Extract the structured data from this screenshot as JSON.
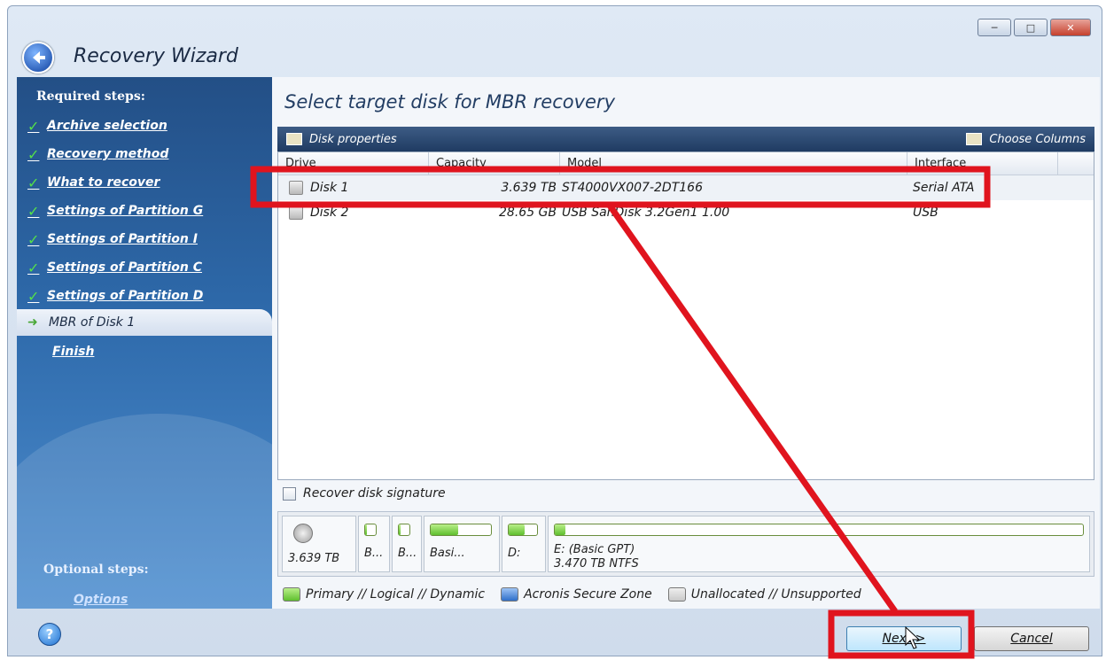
{
  "window": {
    "title": "Recovery Wizard"
  },
  "sidebar": {
    "required_heading": "Required steps:",
    "items": [
      {
        "label": "Archive selection"
      },
      {
        "label": "Recovery method"
      },
      {
        "label": "What to recover"
      },
      {
        "label": "Settings of Partition G"
      },
      {
        "label": "Settings of Partition I"
      },
      {
        "label": "Settings of Partition C"
      },
      {
        "label": "Settings of Partition D"
      }
    ],
    "current": "MBR of Disk 1",
    "finish": "Finish",
    "optional_heading": "Optional steps:",
    "options": "Options"
  },
  "main": {
    "title": "Select target disk for MBR recovery",
    "toolbar": {
      "disk_properties": "Disk properties",
      "choose_columns": "Choose Columns"
    },
    "columns": [
      "Drive",
      "Capacity",
      "Model",
      "Interface"
    ],
    "rows": [
      {
        "drive": "Disk 1",
        "capacity": "3.639 TB",
        "model": "ST4000VX007-2DT166",
        "interface": "Serial ATA",
        "selected": true
      },
      {
        "drive": "Disk 2",
        "capacity": "28.65 GB",
        "model": "USB SanDisk 3.2Gen1 1.00",
        "interface": "USB",
        "selected": false
      }
    ],
    "recover_signature": "Recover disk signature",
    "disk_map": {
      "capacity": "3.639 TB",
      "partitions": [
        {
          "label": "B..."
        },
        {
          "label": "B..."
        },
        {
          "label": "Basi..."
        },
        {
          "label": "D:"
        },
        {
          "label_line1": "E: (Basic GPT)",
          "label_line2": "3.470 TB  NTFS"
        }
      ]
    },
    "legend": [
      {
        "label": "Primary // Logical // Dynamic",
        "color": "#5fbf2e"
      },
      {
        "label": "Acronis Secure Zone",
        "color": "#2f6fc9"
      },
      {
        "label": "Unallocated // Unsupported",
        "color": "#c9c9c9"
      }
    ]
  },
  "footer": {
    "help": "?",
    "next": "Next >",
    "cancel": "Cancel"
  },
  "annotation": {
    "color": "#e0141e"
  }
}
